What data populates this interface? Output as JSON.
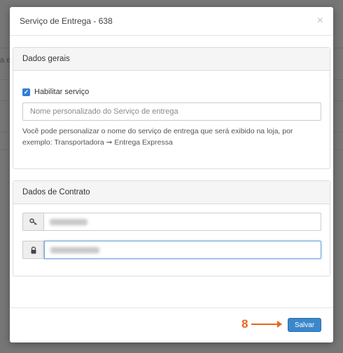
{
  "background": {
    "fragment": "a e"
  },
  "modal": {
    "title": "Serviço de Entrega - 638",
    "close_glyph": "×"
  },
  "general": {
    "heading": "Dados gerais",
    "enable_label": "Habilitar serviço",
    "enable_checked": true,
    "custom_name_placeholder": "Nome personalizado do Serviço de entrega",
    "help_text": "Você pode personalizar o nome do serviço de entrega que será exibido na loja, por exemplo: Transportadora ➞ Entrega Expressa"
  },
  "contract": {
    "heading": "Dados de Contrato",
    "user_icon": "key-icon",
    "password_icon": "lock-icon",
    "user_value_hidden": true,
    "password_value_hidden": true
  },
  "footer": {
    "annotation_number": "8",
    "save_label": "Salvar"
  },
  "colors": {
    "primary": "#3a87cc",
    "annotation": "#e8661e",
    "checkbox": "#2f7fd6"
  }
}
